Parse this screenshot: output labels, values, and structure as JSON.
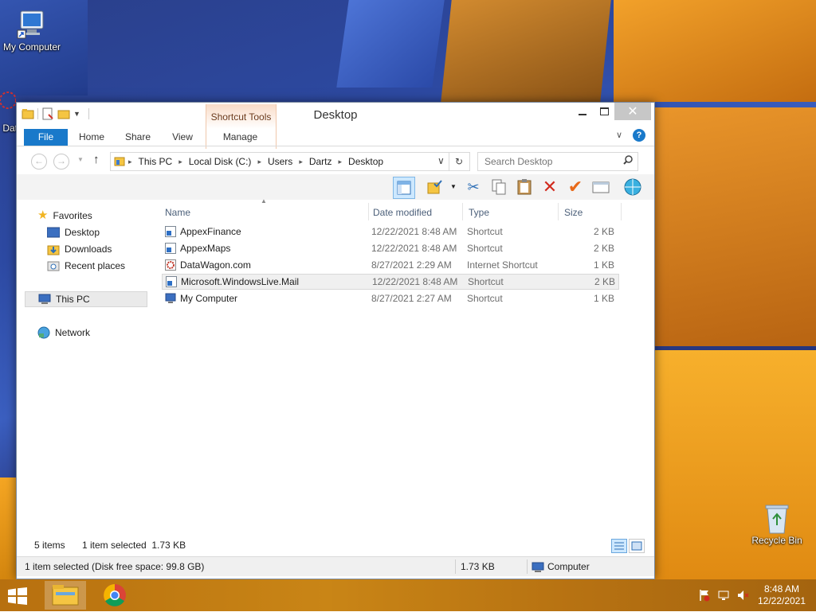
{
  "desktop": {
    "icons": [
      {
        "label": "My Computer"
      },
      {
        "label": "Dat"
      },
      {
        "label": "Recycle Bin"
      }
    ]
  },
  "window": {
    "title": "Desktop",
    "contextual_group": "Shortcut Tools",
    "tabs": [
      "File",
      "Home",
      "Share",
      "View",
      "Manage"
    ],
    "help_label": "?",
    "address": {
      "crumbs": [
        "This PC",
        "Local Disk (C:)",
        "Users",
        "Dartz",
        "Desktop"
      ]
    },
    "search": {
      "placeholder": "Search Desktop"
    },
    "nav": {
      "favorites": "Favorites",
      "favorites_items": [
        "Desktop",
        "Downloads",
        "Recent places"
      ],
      "this_pc": "This PC",
      "network": "Network"
    },
    "columns": {
      "name": "Name",
      "date": "Date modified",
      "type": "Type",
      "size": "Size"
    },
    "files": [
      {
        "name": "AppexFinance",
        "date": "12/22/2021 8:48 AM",
        "type": "Shortcut",
        "size": "2 KB"
      },
      {
        "name": "AppexMaps",
        "date": "12/22/2021 8:48 AM",
        "type": "Shortcut",
        "size": "2 KB"
      },
      {
        "name": "DataWagon.com",
        "date": "8/27/2021 2:29 AM",
        "type": "Internet Shortcut",
        "size": "1 KB"
      },
      {
        "name": "Microsoft.WindowsLive.Mail",
        "date": "12/22/2021 8:48 AM",
        "type": "Shortcut",
        "size": "2 KB"
      },
      {
        "name": "My Computer",
        "date": "8/27/2021 2:27 AM",
        "type": "Shortcut",
        "size": "1 KB"
      }
    ],
    "status": {
      "items": "5 items",
      "selected": "1 item selected  1.73 KB",
      "detail": "1 item selected (Disk free space: 99.8 GB)",
      "size": "1.73 KB",
      "location": "Computer"
    }
  },
  "taskbar": {
    "time": "8:48 AM",
    "date": "12/22/2021"
  },
  "colors": {
    "accent": "#1979ca",
    "contextual": "#f9dcc8",
    "taskbar": "#c98516"
  }
}
